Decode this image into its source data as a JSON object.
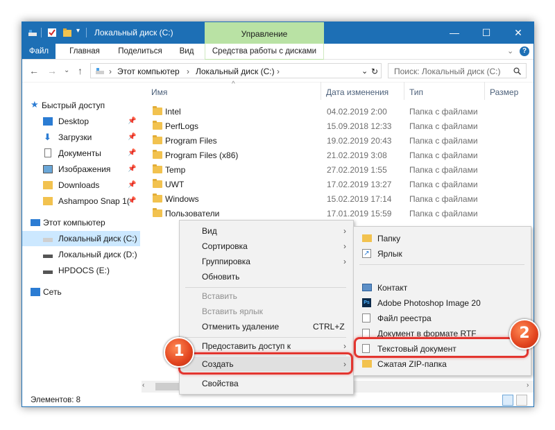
{
  "window": {
    "title": "Локальный диск (C:)",
    "context_tab": "Управление",
    "controls": {
      "minimize": "—",
      "maximize": "☐",
      "close": "✕"
    }
  },
  "ribbon": {
    "tabs": [
      "Файл",
      "Главная",
      "Поделиться",
      "Вид",
      "Средства работы с дисками"
    ]
  },
  "address": {
    "crumbs": [
      "Этот компьютер",
      "Локальный диск (C:)"
    ],
    "search_placeholder": "Поиск: Локальный диск (C:)"
  },
  "sidebar": {
    "items": [
      {
        "label": "Быстрый доступ",
        "icon": "star-icon"
      },
      {
        "label": "Desktop",
        "icon": "desktop-icon"
      },
      {
        "label": "Загрузки",
        "icon": "download-icon"
      },
      {
        "label": "Документы",
        "icon": "document-icon"
      },
      {
        "label": "Изображения",
        "icon": "image-icon"
      },
      {
        "label": "Downloads",
        "icon": "folder-icon"
      },
      {
        "label": "Ashampoo Snap 1(",
        "icon": "folder-icon"
      },
      {
        "label": "Этот компьютер",
        "icon": "computer-icon"
      },
      {
        "label": "Локальный диск (C:)",
        "icon": "drive-icon"
      },
      {
        "label": "Локальный диск (D:)",
        "icon": "drive-icon"
      },
      {
        "label": "HPDOCS (E:)",
        "icon": "drive-icon"
      },
      {
        "label": "Сеть",
        "icon": "network-icon"
      }
    ]
  },
  "columns": {
    "name": "Имя",
    "date": "Дата изменения",
    "type": "Тип",
    "size": "Размер"
  },
  "files": [
    {
      "name": "Intel",
      "date": "04.02.2019 2:00",
      "type": "Папка с файлами"
    },
    {
      "name": "PerfLogs",
      "date": "15.09.2018 12:33",
      "type": "Папка с файлами"
    },
    {
      "name": "Program Files",
      "date": "19.02.2019 20:43",
      "type": "Папка с файлами"
    },
    {
      "name": "Program Files (x86)",
      "date": "21.02.2019 3:08",
      "type": "Папка с файлами"
    },
    {
      "name": "Temp",
      "date": "27.02.2019 1:55",
      "type": "Папка с файлами"
    },
    {
      "name": "UWT",
      "date": "17.02.2019 13:27",
      "type": "Папка с файлами"
    },
    {
      "name": "Windows",
      "date": "15.02.2019 17:14",
      "type": "Папка с файлами"
    },
    {
      "name": "Пользователи",
      "date": "17.01.2019 15:59",
      "type": "Папка с файлами"
    }
  ],
  "context_menu": {
    "items": [
      {
        "label": "Вид",
        "submenu": true
      },
      {
        "label": "Сортировка",
        "submenu": true
      },
      {
        "label": "Группировка",
        "submenu": true
      },
      {
        "label": "Обновить"
      },
      {
        "label": "Вставить",
        "disabled": true
      },
      {
        "label": "Вставить ярлык",
        "disabled": true
      },
      {
        "label": "Отменить удаление",
        "shortcut": "CTRL+Z"
      },
      {
        "label": "Предоставить доступ к",
        "submenu": true
      },
      {
        "label": "Создать",
        "submenu": true
      },
      {
        "label": "Свойства"
      }
    ]
  },
  "submenu": {
    "items": [
      {
        "label": "Папку",
        "icon": "folder-icon"
      },
      {
        "label": "Ярлык",
        "icon": "shortcut-icon"
      },
      {
        "label": "Контакт",
        "icon": "contact-icon"
      },
      {
        "label": "Adobe Photoshop Image 20",
        "icon": "photoshop-icon"
      },
      {
        "label": "Файл реестра",
        "icon": "registry-icon"
      },
      {
        "label": "Документ в формате RTF",
        "icon": "rtf-icon"
      },
      {
        "label": "Текстовый документ",
        "icon": "text-file-icon"
      },
      {
        "label": "Сжатая ZIP-папка",
        "icon": "zip-icon"
      }
    ]
  },
  "annotations": {
    "badge1": "1",
    "badge2": "2"
  },
  "status": {
    "count": "Элементов: 8"
  },
  "colors": {
    "accent": "#1d6fb5",
    "context_tab": "#b9e2a4",
    "highlight": "#e3352f",
    "selection": "#cce8ff"
  }
}
